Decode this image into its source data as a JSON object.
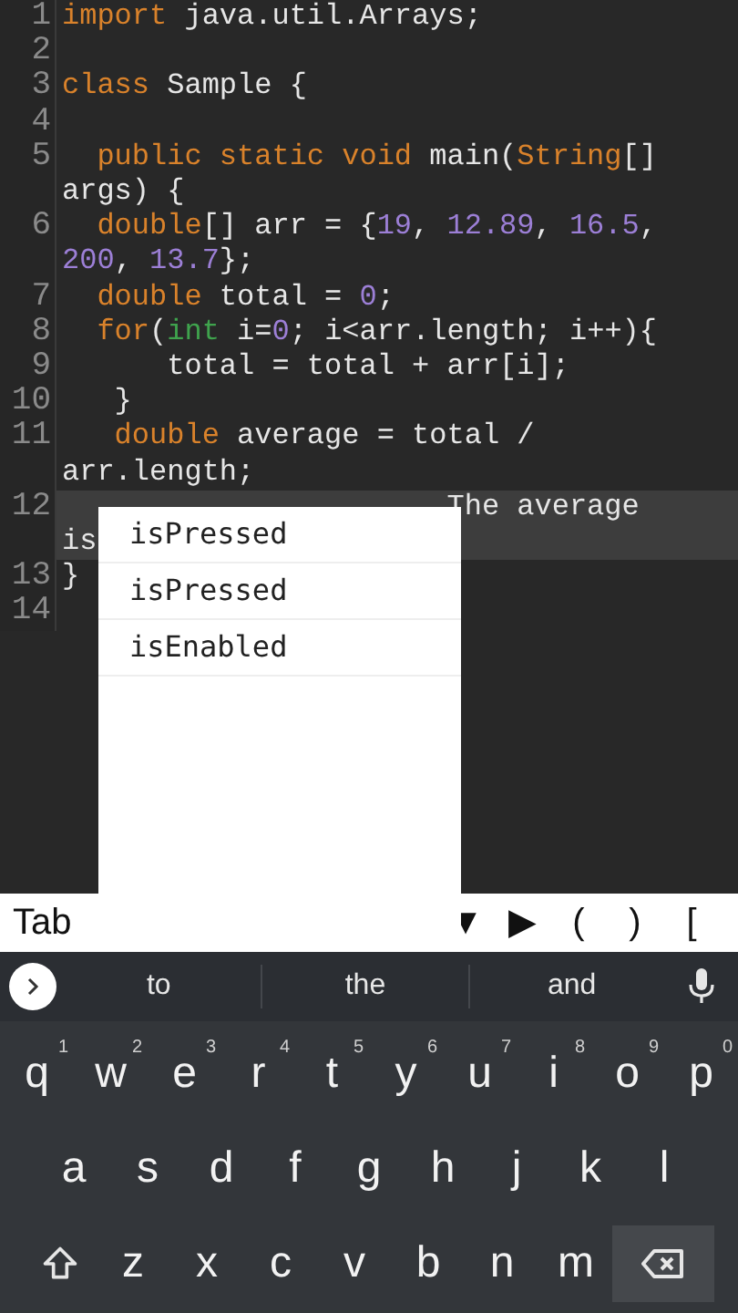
{
  "editor": {
    "lines": [
      {
        "number": "1",
        "current": false,
        "rows": [
          {
            "tokens": [
              {
                "t": "import",
                "kind": "keyword"
              },
              {
                "t": " java.util.Arrays;",
                "kind": "plain"
              }
            ]
          }
        ]
      },
      {
        "number": "2",
        "current": false,
        "rows": [
          {
            "tokens": []
          }
        ]
      },
      {
        "number": "3",
        "current": false,
        "rows": [
          {
            "tokens": [
              {
                "t": "class",
                "kind": "keyword"
              },
              {
                "t": " Sample {",
                "kind": "plain"
              }
            ]
          }
        ]
      },
      {
        "number": "4",
        "current": false,
        "rows": [
          {
            "tokens": []
          }
        ]
      },
      {
        "number": "5",
        "current": false,
        "rows": [
          {
            "tokens": [
              {
                "t": "  public static void",
                "kind": "keyword"
              },
              {
                "t": " main(",
                "kind": "plain"
              },
              {
                "t": "String",
                "kind": "keyword"
              },
              {
                "t": "[]",
                "kind": "plain"
              }
            ]
          },
          {
            "tokens": [
              {
                "t": "args) {",
                "kind": "plain"
              }
            ]
          }
        ]
      },
      {
        "number": "6",
        "current": false,
        "rows": [
          {
            "tokens": [
              {
                "t": "  double",
                "kind": "keyword"
              },
              {
                "t": "[] arr = {",
                "kind": "plain"
              },
              {
                "t": "19",
                "kind": "number"
              },
              {
                "t": ", ",
                "kind": "plain"
              },
              {
                "t": "12.89",
                "kind": "number"
              },
              {
                "t": ", ",
                "kind": "plain"
              },
              {
                "t": "16.5",
                "kind": "number"
              },
              {
                "t": ",",
                "kind": "plain"
              }
            ]
          },
          {
            "tokens": [
              {
                "t": "200",
                "kind": "number"
              },
              {
                "t": ", ",
                "kind": "plain"
              },
              {
                "t": "13.7",
                "kind": "number"
              },
              {
                "t": "};",
                "kind": "plain"
              }
            ]
          }
        ]
      },
      {
        "number": "7",
        "current": false,
        "rows": [
          {
            "tokens": [
              {
                "t": "  double",
                "kind": "keyword"
              },
              {
                "t": " total = ",
                "kind": "plain"
              },
              {
                "t": "0",
                "kind": "number"
              },
              {
                "t": ";",
                "kind": "plain"
              }
            ]
          }
        ]
      },
      {
        "number": "8",
        "current": false,
        "rows": [
          {
            "tokens": [
              {
                "t": "  for",
                "kind": "keyword"
              },
              {
                "t": "(",
                "kind": "plain"
              },
              {
                "t": "int",
                "kind": "type"
              },
              {
                "t": " i=",
                "kind": "plain"
              },
              {
                "t": "0",
                "kind": "number"
              },
              {
                "t": "; i<arr.length; i++){",
                "kind": "plain"
              }
            ]
          }
        ]
      },
      {
        "number": "9",
        "current": false,
        "rows": [
          {
            "tokens": [
              {
                "t": "      total = total + arr[i];",
                "kind": "plain"
              }
            ]
          }
        ]
      },
      {
        "number": "10",
        "current": false,
        "rows": [
          {
            "tokens": [
              {
                "t": "   }",
                "kind": "plain"
              }
            ]
          }
        ]
      },
      {
        "number": "11",
        "current": false,
        "rows": [
          {
            "tokens": [
              {
                "t": "   double",
                "kind": "keyword"
              },
              {
                "t": " average = total /",
                "kind": "plain"
              }
            ]
          },
          {
            "tokens": [
              {
                "t": "arr.length;",
                "kind": "plain"
              }
            ]
          }
        ]
      },
      {
        "number": "12",
        "current": true,
        "rows": [
          {
            "tokens": [
              {
                "t": "The average",
                "kind": "tail"
              }
            ]
          },
          {
            "tokens": [
              {
                "t": "is",
                "kind": "plain"
              }
            ]
          }
        ]
      },
      {
        "number": "13",
        "current": false,
        "rows": [
          {
            "tokens": [
              {
                "t": "}",
                "kind": "plain"
              }
            ]
          }
        ]
      },
      {
        "number": "14",
        "current": false,
        "rows": [
          {
            "tokens": []
          }
        ]
      }
    ]
  },
  "autocomplete": [
    "isPressed",
    "isPressed",
    "isEnabled"
  ],
  "toolbar": {
    "tab": "Tab",
    "keys": [
      "▼",
      "▶",
      "(",
      ")",
      "["
    ]
  },
  "suggestions": {
    "words": [
      "to",
      "the",
      "and"
    ]
  },
  "keyboard": {
    "rows": [
      [
        {
          "kind": "letter",
          "label": "q",
          "hint": "1"
        },
        {
          "kind": "letter",
          "label": "w",
          "hint": "2"
        },
        {
          "kind": "letter",
          "label": "e",
          "hint": "3"
        },
        {
          "kind": "letter",
          "label": "r",
          "hint": "4"
        },
        {
          "kind": "letter",
          "label": "t",
          "hint": "5"
        },
        {
          "kind": "letter",
          "label": "y",
          "hint": "6"
        },
        {
          "kind": "letter",
          "label": "u",
          "hint": "7"
        },
        {
          "kind": "letter",
          "label": "i",
          "hint": "8"
        },
        {
          "kind": "letter",
          "label": "o",
          "hint": "9"
        },
        {
          "kind": "letter",
          "label": "p",
          "hint": "0"
        }
      ],
      [
        {
          "kind": "letter",
          "label": "a"
        },
        {
          "kind": "letter",
          "label": "s"
        },
        {
          "kind": "letter",
          "label": "d"
        },
        {
          "kind": "letter",
          "label": "f"
        },
        {
          "kind": "letter",
          "label": "g"
        },
        {
          "kind": "letter",
          "label": "h"
        },
        {
          "kind": "letter",
          "label": "j"
        },
        {
          "kind": "letter",
          "label": "k"
        },
        {
          "kind": "letter",
          "label": "l"
        }
      ],
      [
        {
          "kind": "shift"
        },
        {
          "kind": "letter",
          "label": "z"
        },
        {
          "kind": "letter",
          "label": "x"
        },
        {
          "kind": "letter",
          "label": "c"
        },
        {
          "kind": "letter",
          "label": "v"
        },
        {
          "kind": "letter",
          "label": "b"
        },
        {
          "kind": "letter",
          "label": "n"
        },
        {
          "kind": "letter",
          "label": "m"
        },
        {
          "kind": "backspace"
        }
      ]
    ]
  }
}
